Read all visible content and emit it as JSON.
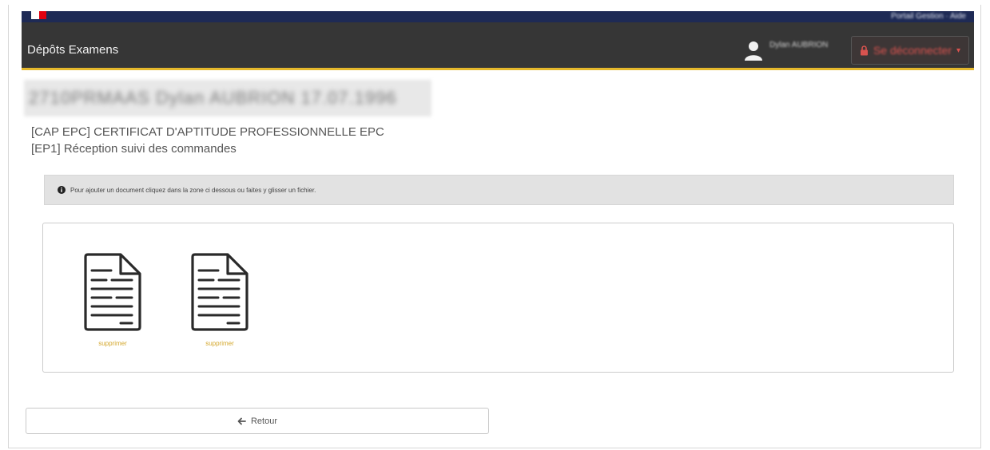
{
  "topbar": {
    "links_text": "Portail Gestion · Aide"
  },
  "navbar": {
    "brand": "Dépôts Examens",
    "user_name": "Dylan AUBRION",
    "logout_label": "Se déconnecter",
    "logout_caret": "▾"
  },
  "header": {
    "candidate_line": "2710PRMAAS Dylan AUBRION 17.07.1996",
    "certificate": "[CAP EPC] CERTIFICAT D'APTITUDE PROFESSIONNELLE EPC",
    "epreuve": "[EP1] Réception suivi des commandes"
  },
  "info": {
    "message": "Pour ajouter un document cliquez dans la zone ci dessous ou faites y glisser un fichier."
  },
  "documents": [
    {
      "delete_label": "supprimer"
    },
    {
      "delete_label": "supprimer"
    }
  ],
  "footer": {
    "back_label": "Retour"
  },
  "colors": {
    "navbar": "#363636",
    "accent_gold": "#e5b82c",
    "logout_red": "#d9534f",
    "top_strip": "#1e2a55"
  }
}
